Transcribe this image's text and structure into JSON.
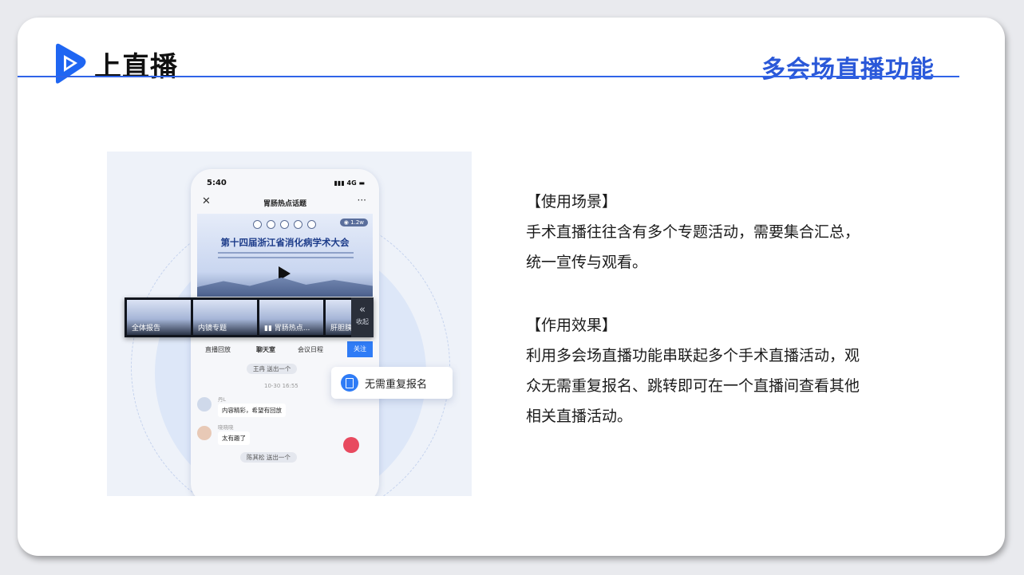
{
  "header": {
    "logo_text": "上直播",
    "title": "多会场直播功能"
  },
  "mockup": {
    "status_time": "5:40",
    "status_network": "4G",
    "nav_title": "胃肠热点话题",
    "view_count": "1.2w",
    "banner_title": "第十四届浙江省消化病学术大会",
    "thumbnails": [
      "全体报告",
      "内镜专题",
      "胃肠热点...",
      "肝胆胰"
    ],
    "collapse_label": "收起",
    "tabs": [
      "直播回放",
      "聊天室",
      "会议日程"
    ],
    "follow_label": "关注",
    "chat": {
      "notice1": "王冉 送出一个",
      "time": "10-30 16:55",
      "msg1_name": "丹L",
      "msg1_text": "内容精彩，希望有回放",
      "msg2_name": "晓晓晓",
      "msg2_text": "太有趣了",
      "notice2": "陈其松 送出一个"
    },
    "callout": "无需重复报名"
  },
  "scenario": {
    "heading": "【使用场景】",
    "line1": "手术直播往往含有多个专题活动，需要集合汇总，",
    "line2": "统一宣传与观看。"
  },
  "effect": {
    "heading": "【作用效果】",
    "line1": "利用多会场直播功能串联起多个手术直播活动，观",
    "line2": "众无需重复报名、跳转即可在一个直播间查看其他",
    "line3": "相关直播活动。"
  },
  "colors": {
    "brand_blue": "#2a58d8",
    "accent_blue": "#2f7cf6"
  }
}
